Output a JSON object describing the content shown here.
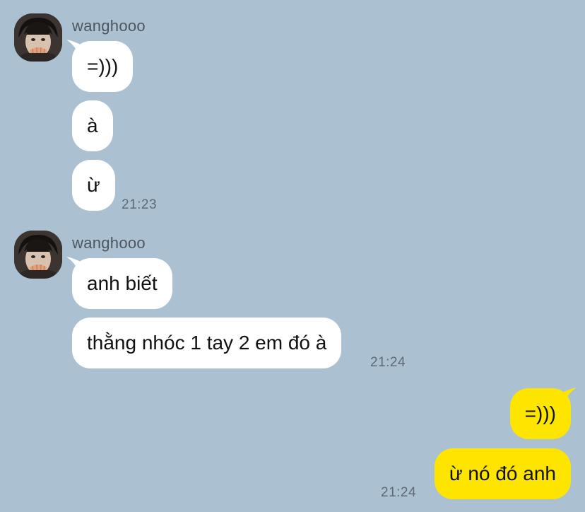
{
  "chat": {
    "groups": [
      {
        "sender": "wanghooo",
        "avatar_icon": "profile-photo",
        "messages": [
          "=)))",
          "à",
          "ừ"
        ],
        "time": "21:23"
      },
      {
        "sender": "wanghooo",
        "avatar_icon": "profile-photo",
        "messages": [
          "anh biết",
          "thằng nhóc 1 tay 2 em đó à"
        ],
        "time": "21:24"
      }
    ],
    "own": {
      "messages": [
        "=)))",
        "ừ nó đó anh"
      ],
      "time": "21:24"
    }
  },
  "colors": {
    "background": "#abc1d1",
    "incoming_bubble": "#ffffff",
    "outgoing_bubble": "#fee500",
    "timestamp": "#5e6b76",
    "sender_name": "#4d5660"
  }
}
